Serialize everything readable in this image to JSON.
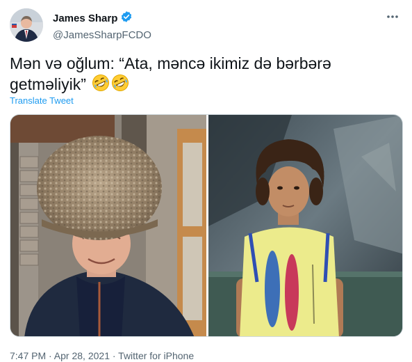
{
  "tweet": {
    "author": {
      "display_name": "James Sharp",
      "handle": "@JamesSharpFCDO",
      "verified": true,
      "verified_color": "#1d9bf0"
    },
    "more_icon": "more-horizontal-icon",
    "text_line1": "Mən və oğlum: “Ata, məncə ikimiz də bərbərə",
    "text_line2": "getməliyik”",
    "emojis": [
      "rolling-on-floor-laughing",
      "rolling-on-floor-laughing"
    ],
    "translate_label": "Translate Tweet",
    "media": {
      "left_photo": "man-in-sheepskin-hat",
      "right_photo": "boy-with-curly-hair"
    },
    "footer": "7:47 PM · Apr 28, 2021 · Twitter for iPhone",
    "colors": {
      "link": "#1d9bf0",
      "secondary_text": "#536471"
    }
  }
}
